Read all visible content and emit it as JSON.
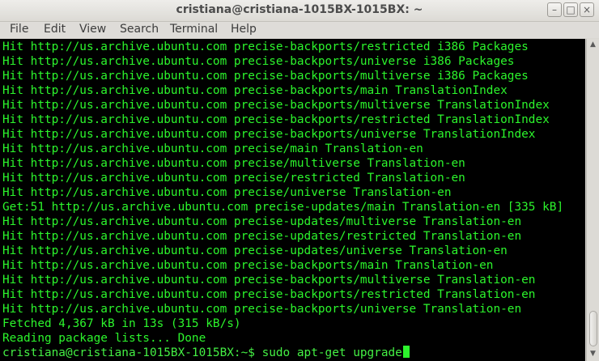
{
  "window": {
    "title": "cristiana@cristiana-1015BX-1015BX: ~",
    "controls": {
      "minimize": "–",
      "maximize": "□",
      "close": "×"
    }
  },
  "menu": [
    "File",
    "Edit",
    "View",
    "Search",
    "Terminal",
    "Help"
  ],
  "terminal": {
    "lines": [
      "Hit http://us.archive.ubuntu.com precise-backports/restricted i386 Packages",
      "Hit http://us.archive.ubuntu.com precise-backports/universe i386 Packages",
      "Hit http://us.archive.ubuntu.com precise-backports/multiverse i386 Packages",
      "Hit http://us.archive.ubuntu.com precise-backports/main TranslationIndex",
      "Hit http://us.archive.ubuntu.com precise-backports/multiverse TranslationIndex",
      "Hit http://us.archive.ubuntu.com precise-backports/restricted TranslationIndex",
      "Hit http://us.archive.ubuntu.com precise-backports/universe TranslationIndex",
      "Hit http://us.archive.ubuntu.com precise/main Translation-en",
      "Hit http://us.archive.ubuntu.com precise/multiverse Translation-en",
      "Hit http://us.archive.ubuntu.com precise/restricted Translation-en",
      "Hit http://us.archive.ubuntu.com precise/universe Translation-en",
      "Get:51 http://us.archive.ubuntu.com precise-updates/main Translation-en [335 kB]",
      "Hit http://us.archive.ubuntu.com precise-updates/multiverse Translation-en",
      "Hit http://us.archive.ubuntu.com precise-updates/restricted Translation-en",
      "Hit http://us.archive.ubuntu.com precise-updates/universe Translation-en",
      "Hit http://us.archive.ubuntu.com precise-backports/main Translation-en",
      "Hit http://us.archive.ubuntu.com precise-backports/multiverse Translation-en",
      "Hit http://us.archive.ubuntu.com precise-backports/restricted Translation-en",
      "Hit http://us.archive.ubuntu.com precise-backports/universe Translation-en",
      "Fetched 4,367 kB in 13s (315 kB/s)",
      "Reading package lists... Done"
    ],
    "prompt": "cristiana@cristiana-1015BX-1015BX:~$ sudo apt-get upgrade"
  },
  "scrollbar": {
    "up_arrow": "▲",
    "down_arrow": "▼"
  },
  "colors": {
    "background": "#000000",
    "text": "#2cf52c"
  }
}
